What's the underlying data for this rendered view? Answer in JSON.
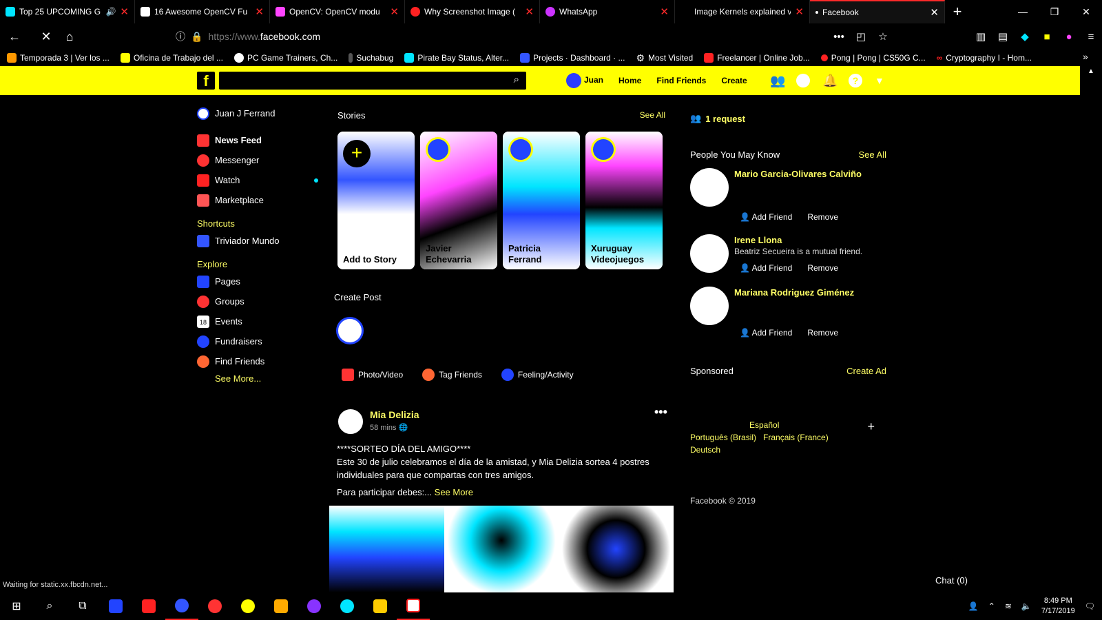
{
  "browser": {
    "tabs": [
      {
        "title": "Top 25 UPCOMING G",
        "color": "#00e5ff"
      },
      {
        "title": "16 Awesome OpenCV Fu",
        "color": "#ffffff"
      },
      {
        "title": "OpenCV: OpenCV modu",
        "color": "#ff44ff"
      },
      {
        "title": "Why Screenshot Image (",
        "color": "#ff2222"
      },
      {
        "title": "WhatsApp",
        "color": "#cc33ff"
      },
      {
        "title": "Image Kernels explained visu",
        "color": "#000000"
      },
      {
        "title": "Facebook",
        "color": "#ffffff"
      }
    ],
    "url_prefix": "https://www.",
    "url_domain": "facebook.com",
    "bookmarks": [
      "Temporada 3 | Ver los ...",
      "Oficina de Trabajo del ...",
      "PC Game Trainers, Ch...",
      "Suchabug",
      "Pirate Bay Status, Alter...",
      "Projects · Dashboard · ...",
      "Most Visited",
      "Freelancer | Online Job...",
      "Pong | Pong | CS50G C...",
      "Cryptography I - Hom..."
    ],
    "status_text": "Waiting for static.xx.fbcdn.net..."
  },
  "fb": {
    "logo": "f",
    "nav": {
      "user": "Juan",
      "home": "Home",
      "find_friends": "Find Friends",
      "create": "Create"
    },
    "left": {
      "profile": "Juan J Ferrand",
      "items": [
        "News Feed",
        "Messenger",
        "Watch",
        "Marketplace"
      ],
      "shortcuts_title": "Shortcuts",
      "shortcut": "Triviador Mundo",
      "explore_title": "Explore",
      "explore": [
        "Pages",
        "Groups",
        "Events",
        "Fundraisers",
        "Find Friends"
      ],
      "see_more": "See More..."
    },
    "stories": {
      "title": "Stories",
      "see_all": "See All",
      "cards": [
        "Add to Story",
        "Javier Echevarria",
        "Patricia Ferrand",
        "Xuruguay Videojuegos"
      ]
    },
    "create_post": {
      "title": "Create Post",
      "actions": [
        "Photo/Video",
        "Tag Friends",
        "Feeling/Activity"
      ]
    },
    "post": {
      "author": "Mia Delizia",
      "time": "58 mins",
      "menu": "•••",
      "line1": "****SORTEO DÍA DEL AMIGO****",
      "line2": "Este 30 de julio celebramos el día de la amistad, y Mia Delizia sortea 4 postres individuales para que compartas con tres amigos.",
      "line3": "Para participar debes:...",
      "see_more": "See More"
    },
    "right": {
      "requests": "1 request",
      "pymk_title": "People You May Know",
      "see_all": "See All",
      "people": [
        {
          "name": "Mario Garcia-Olivares Calviño",
          "mutual": ""
        },
        {
          "name": "Irene Llona",
          "mutual": "Beatriz Secueira is a mutual friend."
        },
        {
          "name": "Mariana Rodriguez Giménez",
          "mutual": ""
        }
      ],
      "add_friend": "Add Friend",
      "remove": "Remove",
      "sponsored": "Sponsored",
      "create_ad": "Create Ad",
      "lang_line1": "Español",
      "lang_line2": "Português (Brasil)   Français (France)",
      "lang_line3": "Deutsch",
      "copyright": "Facebook © 2019",
      "chat": "Chat (0)"
    }
  },
  "taskbar": {
    "time": "8:49 PM",
    "date": "7/17/2019"
  }
}
